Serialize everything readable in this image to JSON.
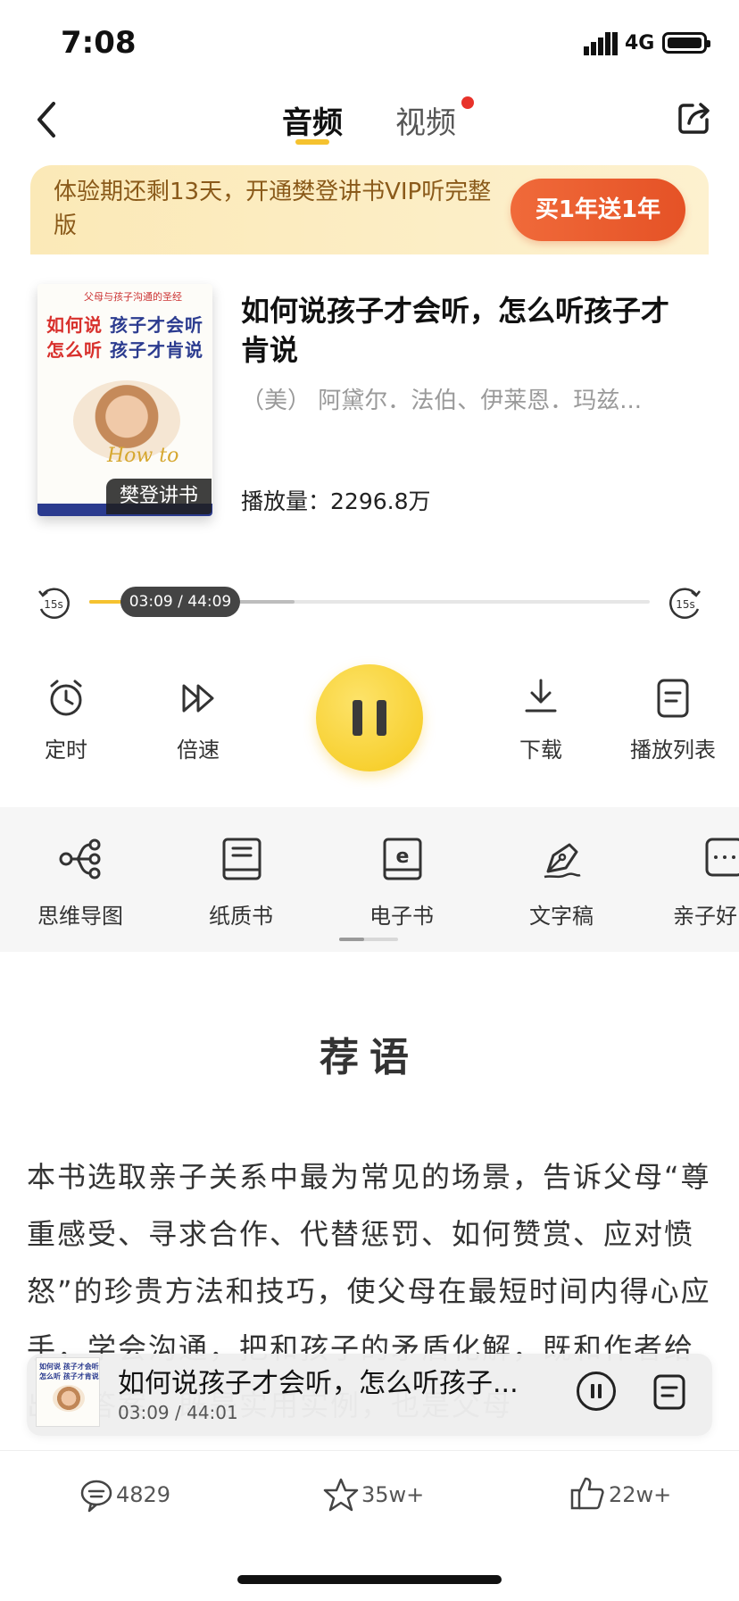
{
  "status": {
    "time": "7:08",
    "network": "4G"
  },
  "nav": {
    "tabs": [
      "音频",
      "视频"
    ]
  },
  "vip": {
    "text": "体验期还剩13天，开通樊登讲书VIP听完整版",
    "button": "买1年送1年"
  },
  "book": {
    "title": "如何说孩子才会听，怎么听孩子才肯说",
    "author": "（美） 阿黛尔．法伯、伊莱恩．玛兹...",
    "plays_label": "播放量：",
    "plays_value": "2296.8万",
    "badge": "樊登讲书",
    "cover": {
      "top": "父母与孩子沟通的圣经",
      "line1_a": "如何说",
      "line1_b": "孩子才会听",
      "line2_a": "怎么听",
      "line2_b": "孩子才肯说",
      "how": "How to"
    }
  },
  "player": {
    "time": "03:09 / 44:09",
    "rewind": "15s",
    "forward": "15s",
    "progress_fraction": 0.07
  },
  "controls": {
    "timer": "定时",
    "speed": "倍速",
    "download": "下载",
    "playlist": "播放列表"
  },
  "features": [
    "思维导图",
    "纸质书",
    "电子书",
    "文字稿",
    "亲子好"
  ],
  "recommend": {
    "title": "荐语",
    "body": "本书选取亲子关系中最为常见的场景，告诉父母“尊重感受、寻求合作、代替惩罚、如何赞赏、应对愤怒”的珍贵方法和技巧，使父母在最短时间内得心应手，学会沟通，把和孩子的矛盾化解，既和作者给出的答案，既是实用实例，也是父母"
  },
  "mini_player": {
    "title": "如何说孩子才会听，怎么听孩子...",
    "time": "03:09 / 44:01",
    "cover_l1": "如何说 孩子才会听",
    "cover_l2": "怎么听 孩子才肯说"
  },
  "bottom_bar": {
    "comments": "4829",
    "favorites": "35w+",
    "likes": "22w+"
  },
  "colors": {
    "accent": "#f5c22f",
    "vip_button": "#e55226",
    "red_dot": "#e8322a"
  }
}
